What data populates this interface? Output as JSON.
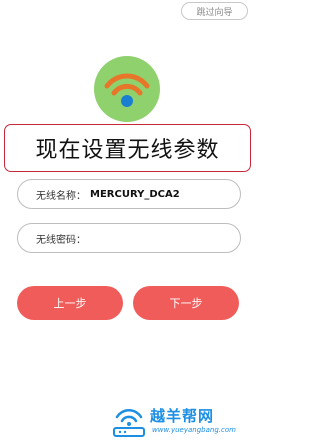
{
  "header": {
    "skip_label": "跳过向导"
  },
  "main": {
    "title": "现在设置无线参数",
    "ssid": {
      "label": "无线名称：",
      "value": "MERCURY_DCA2"
    },
    "password": {
      "label": "无线密码：",
      "value": ""
    },
    "prev_label": "上一步",
    "next_label": "下一步"
  },
  "watermark": {
    "title": "越羊帮网",
    "url": "www.yueyangbang.com"
  },
  "colors": {
    "wifi_circle": "#8fd16d",
    "wifi_arcs": "#e8762a",
    "wifi_dot": "#1a7fd1",
    "primary_button": "#f05c5a",
    "title_border": "#c8283a",
    "watermark": "#1d8fe3"
  },
  "icons": {
    "wifi": "wifi-icon",
    "watermark_logo": "router-wifi-logo"
  }
}
